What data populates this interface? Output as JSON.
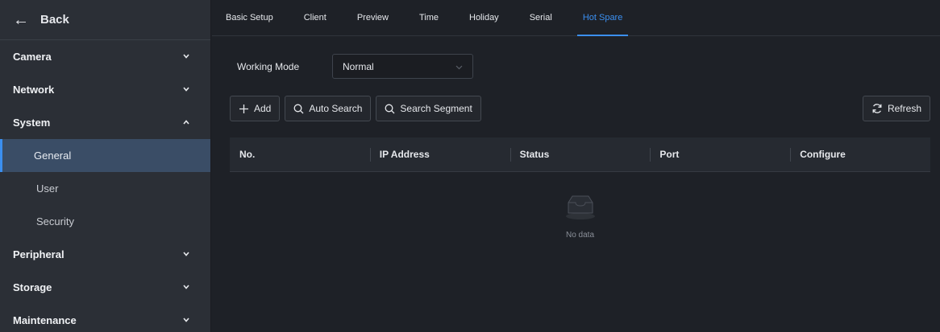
{
  "sidebar": {
    "back_label": "Back",
    "groups": [
      {
        "label": "Camera"
      },
      {
        "label": "Network"
      },
      {
        "label": "System",
        "children": [
          "General",
          "User",
          "Security"
        ]
      },
      {
        "label": "Peripheral"
      },
      {
        "label": "Storage"
      },
      {
        "label": "Maintenance"
      }
    ],
    "active_item": "General"
  },
  "tabs": [
    "Basic Setup",
    "Client",
    "Preview",
    "Time",
    "Holiday",
    "Serial",
    "Hot Spare"
  ],
  "active_tab": "Hot Spare",
  "working_mode": {
    "label": "Working Mode",
    "value": "Normal"
  },
  "toolbar": {
    "add_label": "Add",
    "auto_search_label": "Auto Search",
    "search_segment_label": "Search Segment",
    "refresh_label": "Refresh"
  },
  "table": {
    "columns": [
      "No.",
      "IP Address",
      "Status",
      "Port",
      "Configure"
    ],
    "rows": [],
    "empty_text": "No data"
  },
  "colors": {
    "accent": "#3b8ff0",
    "sidebar_bg": "#2b2f36",
    "main_bg": "#1e2127",
    "active_item_bg": "#3a4d66"
  }
}
